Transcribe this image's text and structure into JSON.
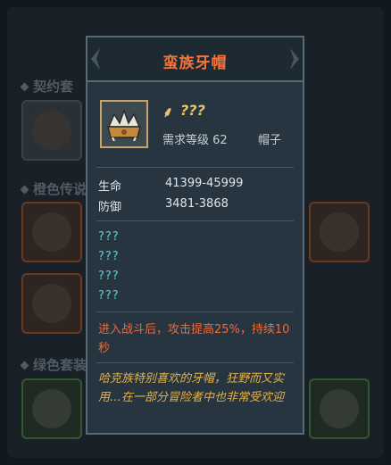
{
  "background": {
    "sections": [
      "契约套",
      "橙色传说",
      "绿色套装"
    ]
  },
  "tooltip": {
    "title": "蛮族牙帽",
    "rarity_icon": "⸙",
    "rarity_text": "???",
    "requirement": "需求等级 62",
    "slot_type": "帽子",
    "stats": [
      {
        "name": "生命",
        "value": "41399-45999"
      },
      {
        "name": "防御",
        "value": "3481-3868"
      }
    ],
    "unknown_lines": [
      "???",
      "???",
      "???",
      "???"
    ],
    "effect": "进入战斗后，攻击提高25%，持续10秒",
    "flavor": "哈克族特别喜欢的牙帽，狂野而又实用…在一部分冒险者中也非常受欢迎",
    "colors": {
      "title": "#f2743a",
      "rarity": "#e5c46a",
      "unknown": "#5fd2d8",
      "effect": "#ee6a3a",
      "flavor": "#e6b24a"
    }
  }
}
